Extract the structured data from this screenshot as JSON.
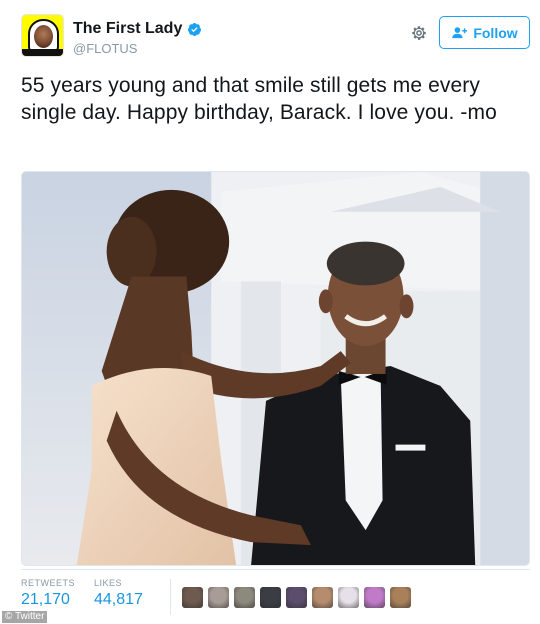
{
  "header": {
    "display_name": "The First Lady",
    "handle": "@FLOTUS",
    "follow_label": "Follow",
    "avatar_icon": "snapchat-ghost-avatar",
    "verified_icon": "verified-badge-icon"
  },
  "tweet": {
    "text": "55 years young and that smile still gets me every single day. Happy birthday, Barack. I love you. -mo"
  },
  "stats": {
    "retweets_label": "RETWEETS",
    "retweets_value": "21,170",
    "likes_label": "LIKES",
    "likes_value": "44,817"
  },
  "likers": [
    "#6e5a4e",
    "#a89c96",
    "#8c8a7c",
    "#3a3d44",
    "#5a4e6c",
    "#b58c6e",
    "#e6e0e8",
    "#c07ac8",
    "#a8805a"
  ],
  "watermark": "© Twitter",
  "colors": {
    "accent": "#1da1f2",
    "link_stat": "#1b95e0",
    "muted": "#8899a6"
  }
}
